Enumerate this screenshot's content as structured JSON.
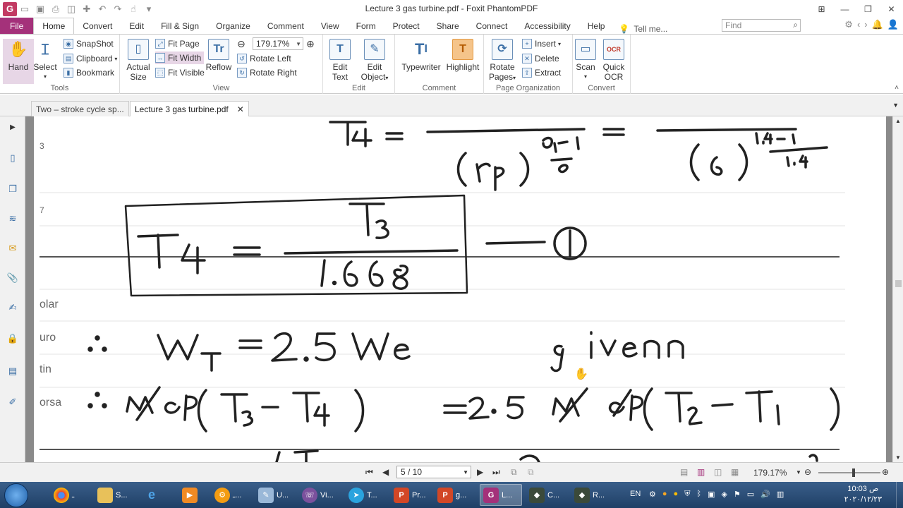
{
  "window": {
    "title": "Lecture 3 gas turbine.pdf - Foxit PhantomPDF",
    "logo": "G"
  },
  "ribbon_tabs": [
    "File",
    "Home",
    "Convert",
    "Edit",
    "Fill & Sign",
    "Organize",
    "Comment",
    "View",
    "Form",
    "Protect",
    "Share",
    "Connect",
    "Accessibility",
    "Help"
  ],
  "active_tab": "Home",
  "tell_me": "Tell me...",
  "find_placeholder": "Find",
  "ribbon": {
    "tools": {
      "label": "Tools",
      "hand": "Hand",
      "select": "Select",
      "snapshot": "SnapShot",
      "clipboard": "Clipboard",
      "bookmark": "Bookmark"
    },
    "view": {
      "label": "View",
      "actual_size_1": "Actual",
      "actual_size_2": "Size",
      "fit_page": "Fit Page",
      "fit_width": "Fit Width",
      "fit_visible": "Fit Visible",
      "reflow": "Reflow",
      "zoom_value": "179.17%",
      "rotate_left": "Rotate Left",
      "rotate_right": "Rotate Right"
    },
    "edit": {
      "label": "Edit",
      "edit_text_1": "Edit",
      "edit_text_2": "Text",
      "edit_object_1": "Edit",
      "edit_object_2": "Object"
    },
    "comment": {
      "label": "Comment",
      "typewriter": "Typewriter",
      "highlight": "Highlight"
    },
    "page_org": {
      "label": "Page Organization",
      "rotate_pages_1": "Rotate",
      "rotate_pages_2": "Pages",
      "insert": "Insert",
      "delete": "Delete",
      "extract": "Extract"
    },
    "convert": {
      "label": "Convert",
      "scan": "Scan",
      "quick_ocr_1": "Quick",
      "quick_ocr_2": "OCR"
    }
  },
  "doc_tabs": [
    {
      "label": "Two – stroke cycle sp...",
      "active": false
    },
    {
      "label": "Lecture 3 gas turbine.pdf",
      "active": true
    }
  ],
  "page_margin_texts": [
    "3",
    "7",
    "olar",
    "uro",
    "tin",
    "orsa"
  ],
  "status": {
    "page_display": "5 / 10",
    "zoom": "179.17%"
  },
  "taskbar": {
    "items": [
      {
        "icon": "chrome-icon",
        "label": "ـ"
      },
      {
        "icon": "folder-icon",
        "label": "S..."
      },
      {
        "icon": "ie-icon",
        "label": ""
      },
      {
        "icon": "media-icon",
        "label": ""
      },
      {
        "icon": "settings-app-icon",
        "label": "ـ..."
      },
      {
        "icon": "paint-icon",
        "label": "U..."
      },
      {
        "icon": "viber-icon",
        "label": "Vi..."
      },
      {
        "icon": "telegram-icon",
        "label": "T..."
      },
      {
        "icon": "powerpoint-icon",
        "label": "Pr..."
      },
      {
        "icon": "powerpoint-icon-2",
        "label": "g..."
      },
      {
        "icon": "foxit-icon",
        "label": "L..."
      },
      {
        "icon": "app-icon-c",
        "label": "C..."
      },
      {
        "icon": "app-icon-r",
        "label": "R..."
      }
    ],
    "language": "EN",
    "time": "10:03 ص",
    "date": "٢٠٢٠/١٢/٢٣"
  },
  "colors": {
    "file_tab": "#a4317a",
    "selected_button": "#e7d6e6",
    "taskbar": "#2a4d78"
  }
}
